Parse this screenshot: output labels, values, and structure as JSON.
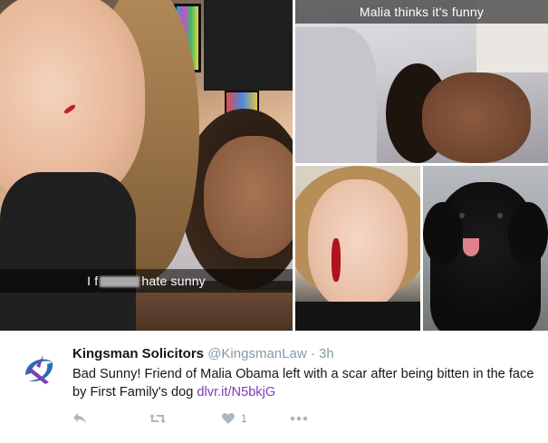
{
  "media": {
    "photo1": {
      "caption_prefix": "I f",
      "caption_suffix": "hate sunny"
    },
    "photo2": {
      "caption": "Malia thinks it's funny"
    }
  },
  "tweet": {
    "name": "Kingsman Solicitors",
    "handle": "@KingsmanLaw",
    "separator": "·",
    "time": "3h",
    "text": "Bad Sunny! Friend of Malia Obama left with a scar after being bitten in the face by First Family's dog",
    "link": "dlvr.it/N5bkjG",
    "like_count": "1",
    "icons": [
      "reply-icon",
      "retweet-icon",
      "like-icon",
      "more-icon"
    ],
    "colors": {
      "link": "#7f3ab5",
      "avatar_blue": "#2b6cb0",
      "avatar_purple": "#7b3fb0",
      "muted": "#aab8c2"
    }
  }
}
